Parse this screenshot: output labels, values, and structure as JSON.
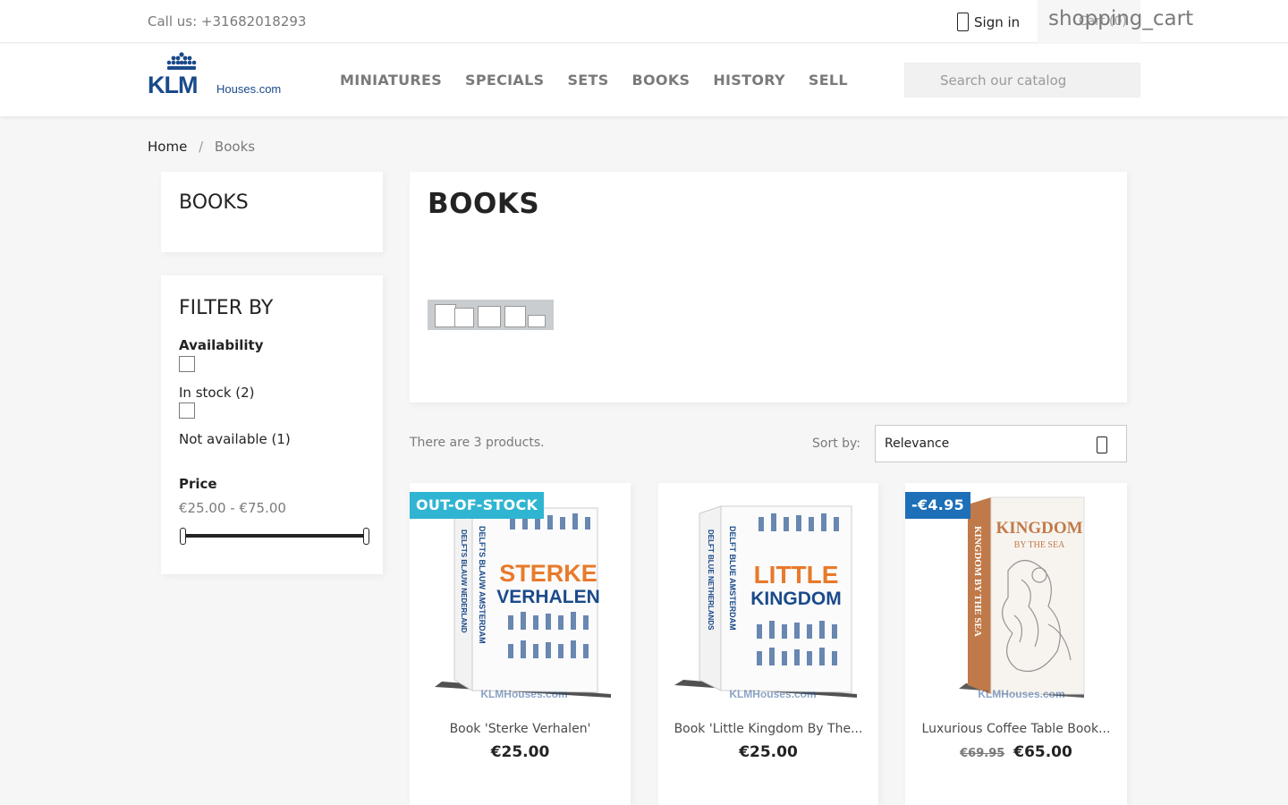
{
  "topbar": {
    "call": "Call us: +31682018293",
    "signin": "Sign in",
    "cart_word": "shopping_cart",
    "cart_count": "Cart (0)"
  },
  "header": {
    "logo_klm": "KLM",
    "logo_houses": "Houses.com",
    "nav": [
      "MINIATURES",
      "SPECIALS",
      "SETS",
      "BOOKS",
      "HISTORY",
      "SELL"
    ],
    "search_placeholder": "Search our catalog"
  },
  "breadcrumb": {
    "home": "Home",
    "sep": "/",
    "current": "Books"
  },
  "sidebar": {
    "category_title": "BOOKS",
    "filter_title": "FILTER BY",
    "availability_title": "Availability",
    "availability_options": [
      "In stock (2)",
      "Not available (1)"
    ],
    "price_title": "Price",
    "price_range": "€25.00 - €75.00",
    "price_slider": {
      "min": 25,
      "max": 75,
      "low": 25,
      "high": 75
    }
  },
  "main": {
    "title": "BOOKS",
    "count_text": "There are 3 products.",
    "sort_label": "Sort by:",
    "sort_value": "Relevance"
  },
  "products": [
    {
      "flag": "OUT-OF-STOCK",
      "name": "Book 'Sterke Verhalen'",
      "price": "€25.00",
      "cover_title_1": "STERKE",
      "cover_title_2": "VERHALEN",
      "spine_1": "DELFTS BLAUW AMSTERDAM",
      "spine_2": "DELFTS BLAUW NEDERLAND",
      "cover_color": "#e87a2a"
    },
    {
      "name": "Book 'Little Kingdom By The...",
      "price": "€25.00",
      "cover_title_1": "LITTLE",
      "cover_title_2": "KINGDOM",
      "spine_1": "DELFT BLUE AMSTERDAM",
      "spine_2": "DELFT BLUE NETHERLANDS",
      "cover_color": "#e87a2a"
    },
    {
      "flag": "-€4.95",
      "name": "Luxurious Coffee Table Book...",
      "old_price": "€69.95",
      "price": "€65.00",
      "cover_title_1": "KINGDOM",
      "cover_title_2": "BY THE SEA",
      "spine_1": "KINGDOM BY THE SEA",
      "cover_color": "#c07a4a"
    }
  ],
  "watermark": "KLMHouses.com"
}
